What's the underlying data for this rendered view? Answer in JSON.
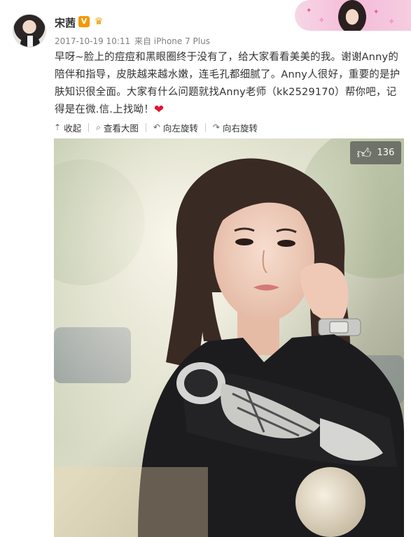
{
  "post": {
    "username": "宋茜",
    "verified_badge": "V",
    "timestamp": "2017-10-19 10:11",
    "source": "来自 iPhone 7 Plus",
    "text": "早呀~脸上的痘痘和黑眼圈终于没有了，给大家看看美美的我。谢谢Anny的陪伴和指导，皮肤越来越水嫩，连毛孔都细腻了。Anny人很好，重要的是护肤知识很全面。大家有什么问题就找Anny老师（kk2529170）帮你吧，记得是在微.信.上找呦！",
    "emoji": "heart-icon"
  },
  "toolbar": {
    "collapse": "收起",
    "view_large": "查看大图",
    "rotate_left": "向左旋转",
    "rotate_right": "向右旋转"
  },
  "photo": {
    "like_count": "136"
  },
  "colors": {
    "verified": "#f39800",
    "heart": "#e0152e",
    "banner": "#f4bcd8"
  }
}
